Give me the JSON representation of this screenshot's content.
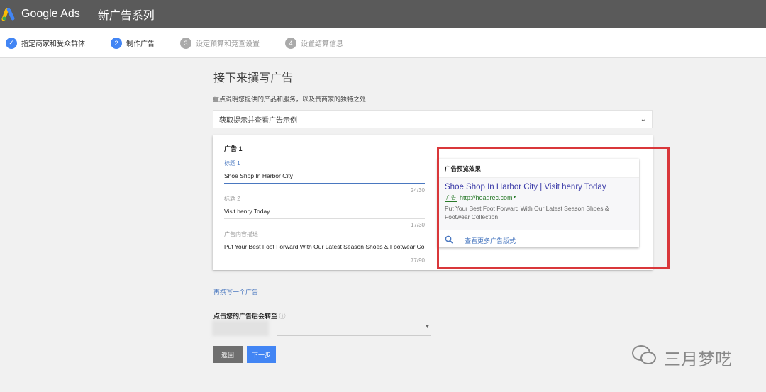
{
  "header": {
    "brand": "Google Ads",
    "page_title": "新广告系列"
  },
  "steps": [
    {
      "num": "✓",
      "label": "指定商家和受众群体",
      "state": "done"
    },
    {
      "num": "2",
      "label": "制作广告",
      "state": "active"
    },
    {
      "num": "3",
      "label": "设定预算和竞查设置",
      "state": "pending"
    },
    {
      "num": "4",
      "label": "设置结算信息",
      "state": "pending"
    }
  ],
  "main": {
    "heading": "接下来撰写广告",
    "subheading": "重点说明您提供的产品和服务，以及贵商家的独特之处",
    "tips_label": "获取提示并查看广告示例",
    "ad": {
      "title": "广告 1",
      "fields": [
        {
          "label": "标题 1",
          "value": "Shoe Shop In Harbor City",
          "count": "24/30"
        },
        {
          "label": "标题 2",
          "value": "Visit henry Today",
          "count": "17/30"
        },
        {
          "label": "广告内容描述",
          "value": "Put Your Best Foot Forward With Our Latest Season Shoes & Footwear Collection",
          "count": "77/90"
        }
      ]
    },
    "preview": {
      "header": "广告预览效果",
      "title": "Shoe Shop In Harbor City | Visit henry Today",
      "badge": "广告",
      "url": "http://headrec.com",
      "description": "Put Your Best Foot Forward With Our Latest Season Shoes & Footwear Collection",
      "more_formats": "查看更多广告版式"
    },
    "write_another": "再撰写一个广告",
    "destination_label": "点击您的广告后会转至",
    "back_button": "返回",
    "next_button": "下一步"
  },
  "watermark": "三月梦呓",
  "colors": {
    "accent": "#4285f4",
    "highlight": "#d9373a",
    "topbar": "#5a5a5a"
  }
}
